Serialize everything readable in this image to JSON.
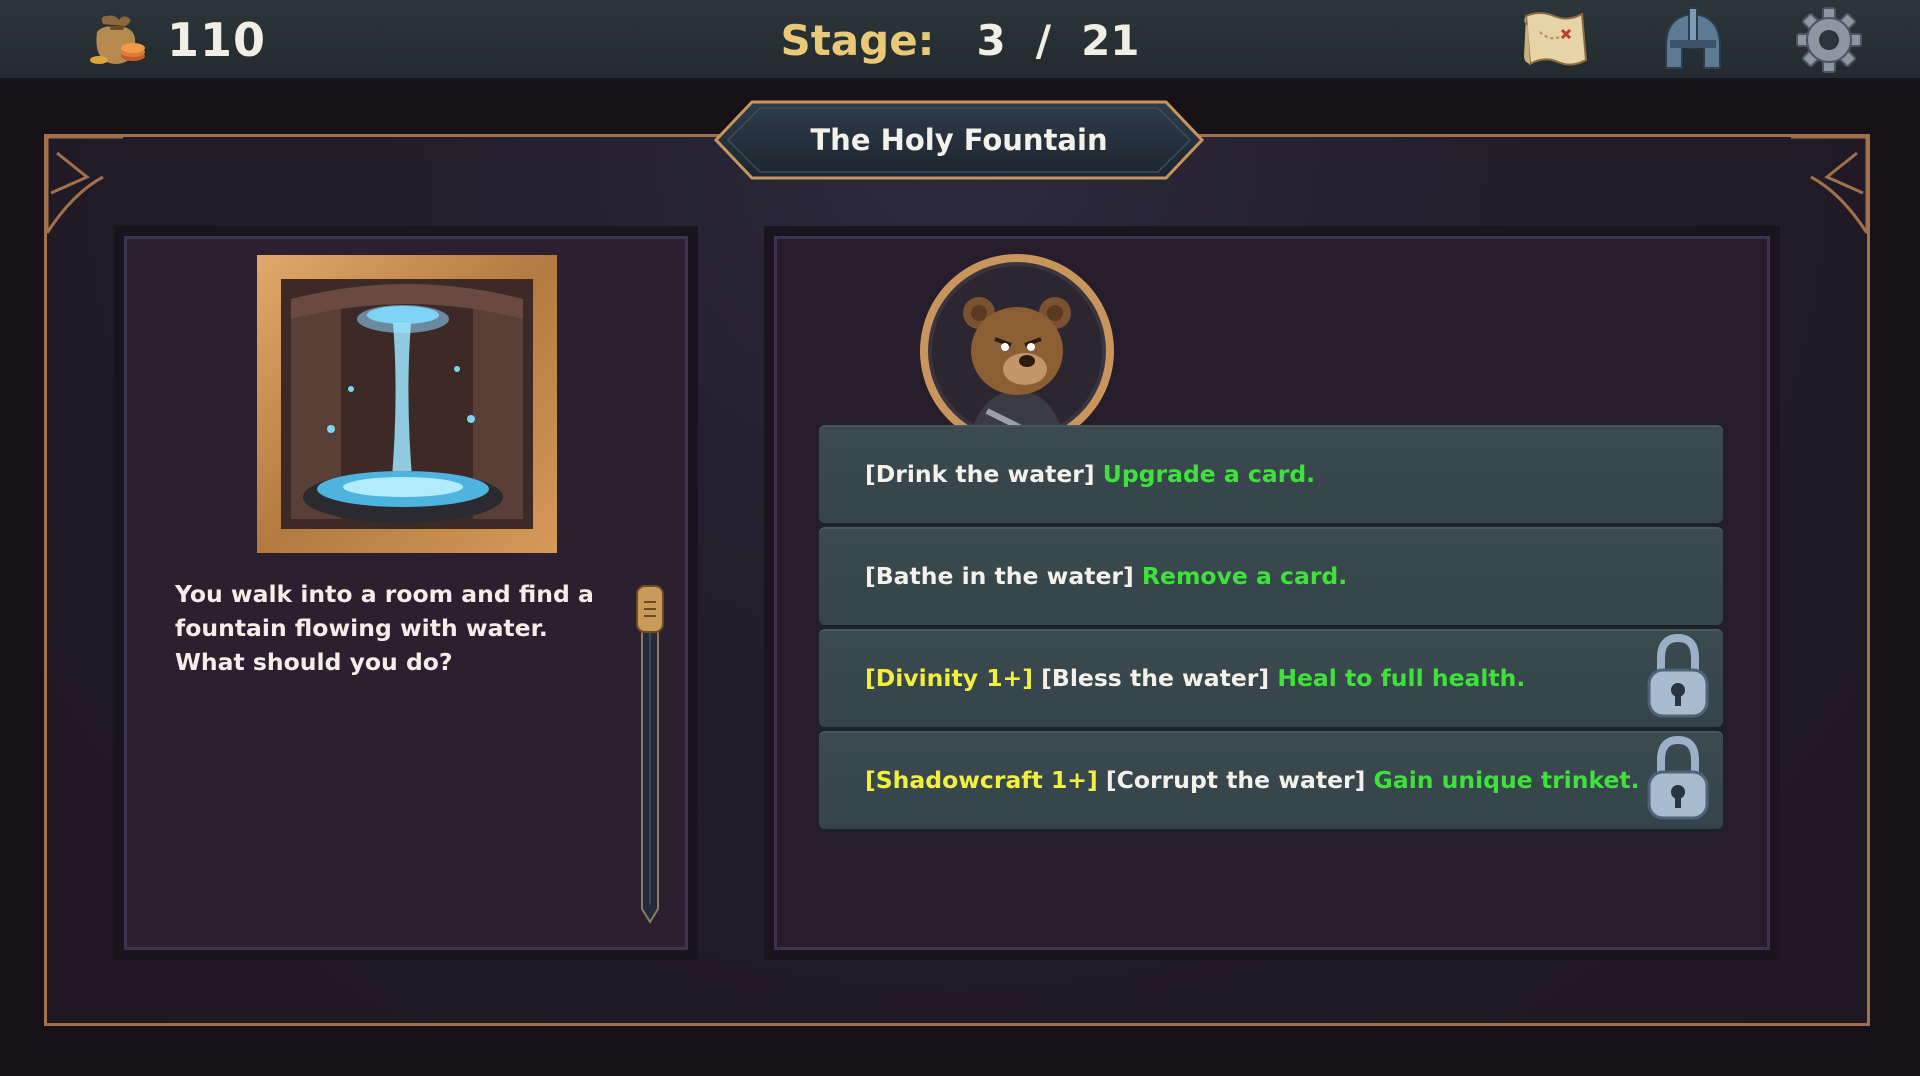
{
  "hud": {
    "gold": "110",
    "stage_label": "Stage:",
    "stage_current": "3",
    "stage_separator": "/",
    "stage_total": "21",
    "icons": [
      "money-bag-icon",
      "map-icon",
      "helmet-icon",
      "gear-icon"
    ]
  },
  "event": {
    "title": "The Holy Fountain",
    "description": "You walk into a room and find a fountain flowing with water. What should you do?",
    "image": "holy-fountain-illustration",
    "npc": "bear-warrior-portrait"
  },
  "options": [
    {
      "tag": "",
      "action": "[Drink the water]",
      "result": "Upgrade a card.",
      "locked": false
    },
    {
      "tag": "",
      "action": "[Bathe in the water]",
      "result": "Remove a card.",
      "locked": false
    },
    {
      "tag": "[Divinity 1+]",
      "action": "[Bless the water]",
      "result": "Heal to full health.",
      "locked": true
    },
    {
      "tag": "[Shadowcraft 1+]",
      "action": "[Corrupt the water]",
      "result": "Gain unique trinket.",
      "locked": true
    }
  ],
  "colors": {
    "stage_label": "#e9c877",
    "result_text": "#3ee23a",
    "requirement_text": "#f2f03c",
    "frame_border": "#a0714a",
    "option_bg": "#3a4a4f"
  }
}
